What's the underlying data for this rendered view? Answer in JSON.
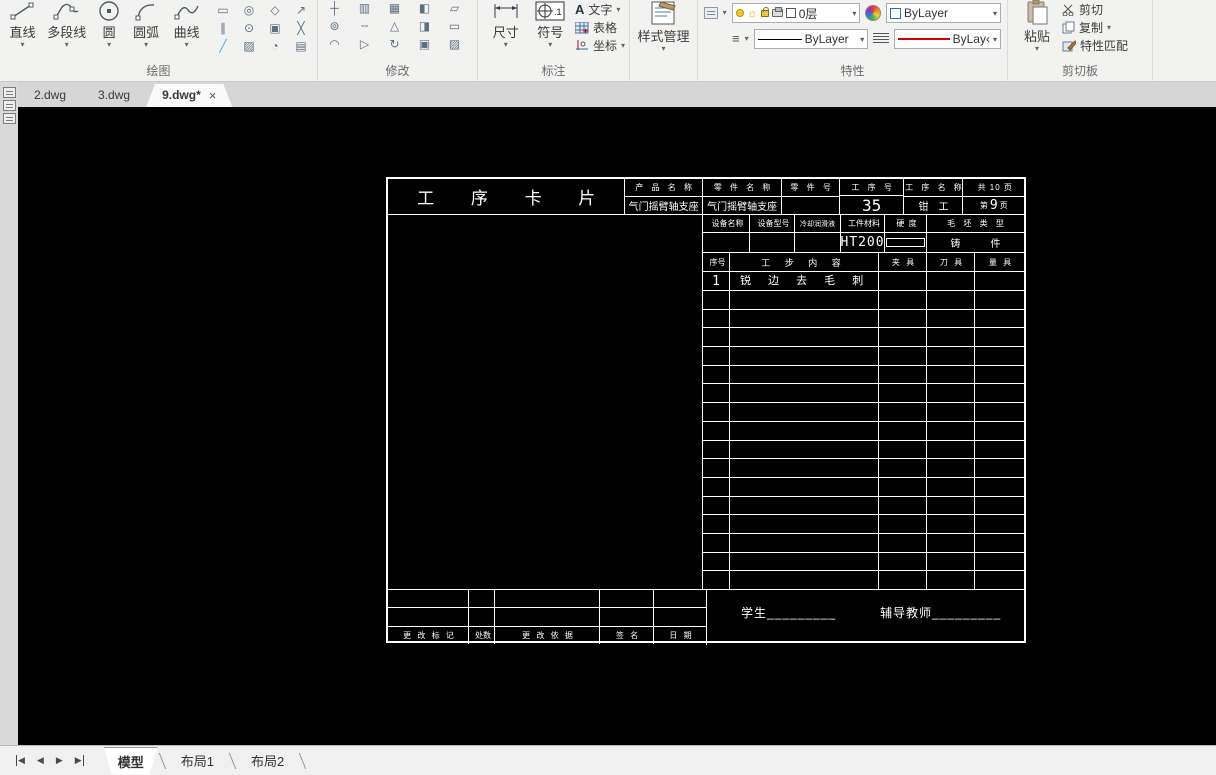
{
  "icons": {
    "caret": "▾",
    "close": "×",
    "menu_lines": "≡",
    "prev": "◀",
    "next": "▶",
    "sun": "☼",
    "text_a": "A",
    "draw_grid": [
      "▭",
      "◎",
      "◇",
      "↗",
      "∥",
      "⊙",
      "▣",
      "╳",
      "╱",
      "▨",
      "◔",
      "▤"
    ],
    "modify_grid": [
      "┼",
      "▥",
      "▦",
      "◧",
      "▱",
      "⊚",
      "╌",
      "△",
      "◨",
      "▭",
      "◠",
      "▷",
      "↻",
      "▣",
      "▨"
    ]
  },
  "ribbon": {
    "draw": {
      "label": "绘图",
      "buttons": [
        {
          "label": "直线"
        },
        {
          "label": "多段线"
        },
        {
          "label": "圆"
        },
        {
          "label": "圆弧"
        },
        {
          "label": "曲线"
        }
      ]
    },
    "modify": {
      "label": "修改"
    },
    "annotate": {
      "label": "标注",
      "dim": "尺寸",
      "sym": "符号",
      "sym_badge": ".1",
      "text": "文字",
      "table": "表格",
      "coord": "坐标"
    },
    "style": {
      "label": "样式管理"
    },
    "props": {
      "label": "特性",
      "layer": "0层",
      "color": "ByLayer",
      "linetype": "ByLayer",
      "linetype2": "ByLay‹"
    },
    "clip": {
      "label": "剪切板",
      "paste": "粘贴",
      "cut": "剪切",
      "copy": "复制",
      "match": "特性匹配"
    }
  },
  "doc_tabs": {
    "items": [
      {
        "label": "2.dwg"
      },
      {
        "label": "3.dwg"
      },
      {
        "label": "9.dwg*"
      }
    ]
  },
  "sheet": {
    "title": "工  序  卡  片",
    "header": {
      "product_label": "产 品 名 称",
      "product_value": "气门摇臂轴支座",
      "part_label": "零 件 名 称",
      "part_value": "气门摇臂轴支座",
      "partno_label": "零 件 号",
      "partno_value": "",
      "opno_label": "工 序 号",
      "opno_value": "35",
      "opname_label": "工 序 名 称",
      "opname_value": "钳　工",
      "pages_label": "共 10 页",
      "page_prefix": "第",
      "page_num": "9",
      "page_suffix": "页"
    },
    "equip": {
      "labels": [
        "设备名称",
        "设备型号",
        "冷却润滑液",
        "工件材料",
        "硬 度",
        "毛 坯 类 型"
      ],
      "material_value": "HT200",
      "blank_type_value": "铸　　　件"
    },
    "steps": {
      "headers": [
        "序号",
        "工 步 内 容",
        "夹 具",
        "刀 具",
        "量 具"
      ],
      "rows": [
        {
          "no": "1",
          "content": "锐 边 去 毛 刺",
          "fixture": "",
          "tool": "",
          "gauge": ""
        }
      ],
      "empty_row_count": 16
    },
    "revision": {
      "labels": [
        "更 改 标 记",
        "处数",
        "更 改 依 据",
        "签  名",
        "日  期"
      ]
    },
    "footer": {
      "student": "学生_________",
      "advisor": "辅导教师_________"
    }
  },
  "model_bar": {
    "model": "模型",
    "layout1": "布局1",
    "layout2": "布局2"
  }
}
